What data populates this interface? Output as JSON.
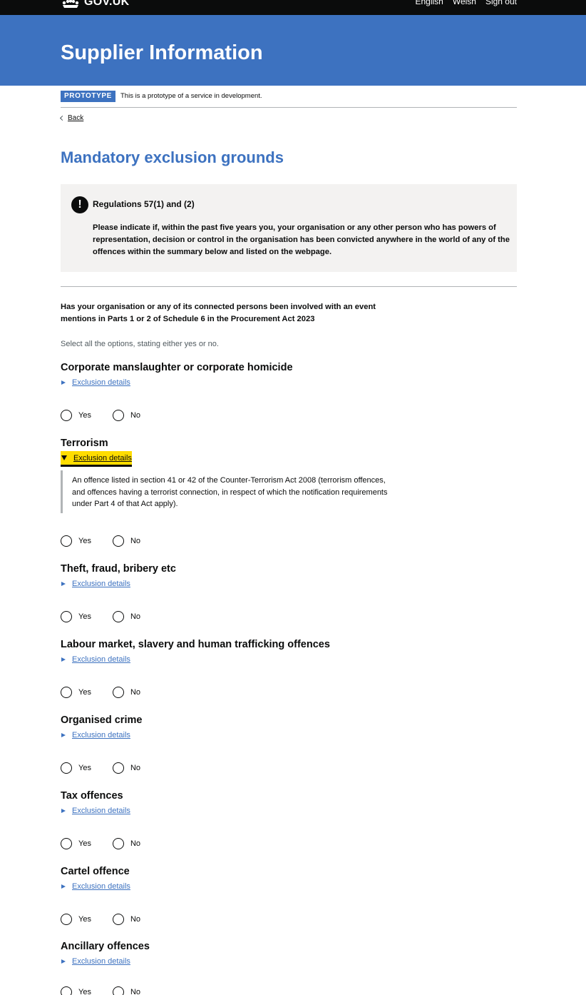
{
  "header": {
    "brand": "GOV.UK",
    "links": [
      "English",
      "Welsh",
      "Sign out"
    ],
    "service_name": "Supplier Information"
  },
  "phase_banner": {
    "tag": "PROTOTYPE",
    "text": "This is a prototype of a service in development."
  },
  "back_link": "Back",
  "page_title": "Mandatory exclusion grounds",
  "warning": {
    "icon": "!",
    "title": "Regulations 57(1) and (2)",
    "body": "Please indicate if, within the past five years you, your organisation or any other person who has powers of representation, decision or control in the organisation has been convicted anywhere in the world of any of the offences within the summary below and listed on the webpage."
  },
  "question": "Has your organisation or any of its connected persons been involved with an event mentions in Parts 1 or 2 of Schedule 6 in the Procurement Act 2023",
  "hint": "Select all the options, stating either yes or no.",
  "details_label": "Exclusion details",
  "radio_labels": {
    "yes": "Yes",
    "no": "No"
  },
  "sections": [
    {
      "title": "Corporate manslaughter or corporate homicide",
      "open": false
    },
    {
      "title": "Terrorism",
      "open": true,
      "details_text": "An offence listed in section 41 or 42 of the Counter-Terrorism Act 2008 (terrorism offences, and offences having a terrorist connection, in respect of which the notification requirements under Part 4 of that Act apply)."
    },
    {
      "title": "Theft, fraud, bribery etc",
      "open": false
    },
    {
      "title": "Labour market, slavery and human trafficking offences",
      "open": false
    },
    {
      "title": "Organised crime",
      "open": false
    },
    {
      "title": "Tax offences",
      "open": false
    },
    {
      "title": "Cartel offence",
      "open": false
    },
    {
      "title": "Ancillary offences",
      "open": false
    }
  ],
  "colors": {
    "brand_blue": "#3d72c0",
    "focus_yellow": "#ffdd00",
    "panel_grey": "#f3f2f1",
    "text": "#0b0c0c"
  }
}
